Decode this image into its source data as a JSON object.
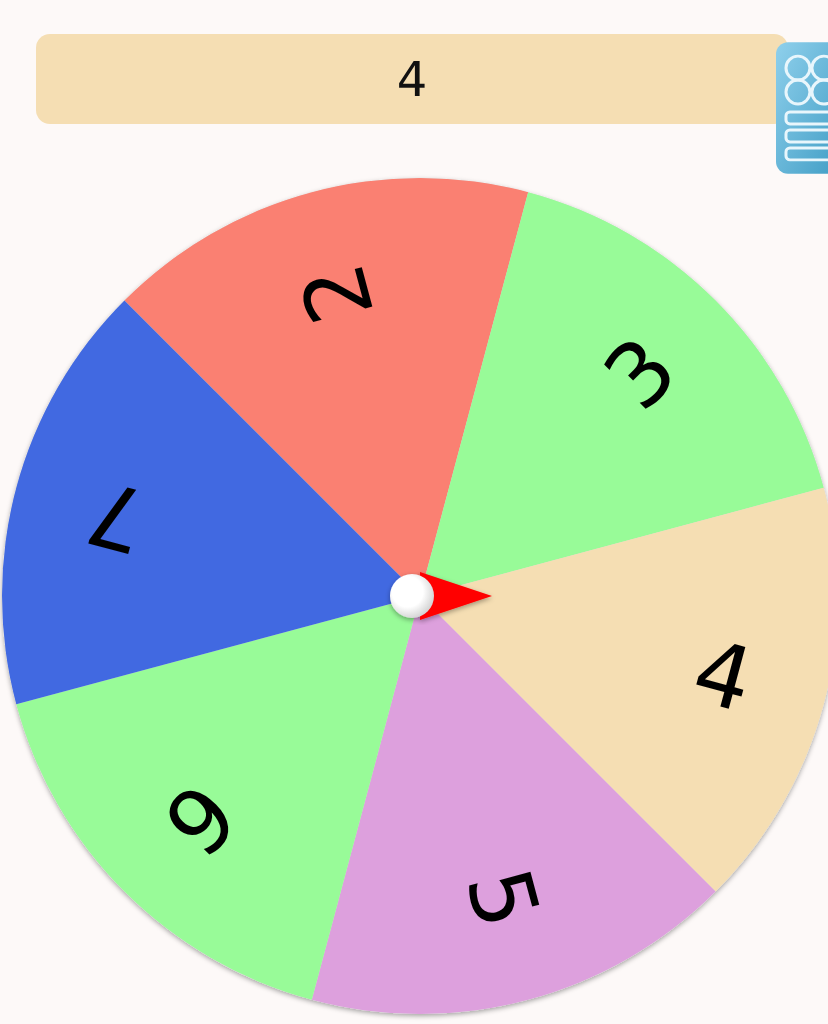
{
  "result": "4",
  "segments": [
    {
      "label": "2",
      "color": "#fa8072"
    },
    {
      "label": "3",
      "color": "#98fb98"
    },
    {
      "label": "4",
      "color": "#f5deb3"
    },
    {
      "label": "5",
      "color": "#dda0dd"
    },
    {
      "label": "6",
      "color": "#98fb98"
    },
    {
      "label": "7",
      "color": "#4169e1"
    }
  ]
}
